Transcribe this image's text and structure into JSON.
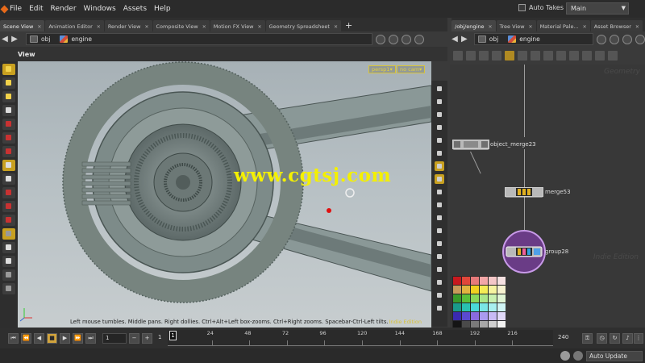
{
  "menu": [
    "File",
    "Edit",
    "Render",
    "Windows",
    "Assets",
    "Help"
  ],
  "auto_takes_label": "Auto Takes",
  "workspace": "Main",
  "left_tabs": [
    "Scene View",
    "Animation Editor",
    "Render View",
    "Composite View",
    "Motion FX View",
    "Geometry Spreadsheet"
  ],
  "right_tabs": [
    "/obj/engine",
    "Tree View",
    "Material Pale...",
    "Asset Browser"
  ],
  "left_path": {
    "segments": [
      "obj",
      "engine"
    ]
  },
  "right_path": {
    "segments": [
      "obj",
      "engine"
    ]
  },
  "view_title": "View",
  "camera": {
    "persp": "persp1▾",
    "cam": "no cam▾"
  },
  "viewport_status": "Left mouse tumbles. Middle pans. Right dollies. Ctrl+Alt+Left box-zooms. Ctrl+Right zooms. Spacebar-Ctrl-Left tilts.",
  "indie_edition": "Indie Edition",
  "watermark": "www.cgtsj.com",
  "network": {
    "context_label": "Geometry",
    "indie_label": "Indie Edition",
    "nodes": [
      {
        "name": "object_merge23"
      },
      {
        "name": "merge53"
      },
      {
        "name": "group28"
      }
    ]
  },
  "palette_colors": [
    "#c8191e",
    "#e0473a",
    "#e67a7a",
    "#f2a7a7",
    "#f4c7c7",
    "#f6e1e1",
    "#c89a5a",
    "#e0b440",
    "#f0d020",
    "#f5ec55",
    "#f6f3a0",
    "#f6f2d0",
    "#3a9a2a",
    "#5ac03a",
    "#8ad85a",
    "#aae68a",
    "#c8f0b0",
    "#e0f5d5",
    "#1a9a8a",
    "#2ac0b0",
    "#4ad8d8",
    "#7ae6e6",
    "#a8f0f0",
    "#d0f5f5",
    "#3a2ab0",
    "#5a4ad0",
    "#8a6ae0",
    "#aa9af0",
    "#c8baf5",
    "#e0d8f8",
    "#151515",
    "#4a4a4a",
    "#7a7a7a",
    "#a8a8a8",
    "#d0d0d0",
    "#f2f2f2"
  ],
  "timeline": {
    "current_frame": "1",
    "range_start": "1",
    "range_start2": "1",
    "range_end": "240",
    "ticks": [
      "24",
      "48",
      "72",
      "96",
      "120",
      "144",
      "168",
      "192",
      "216"
    ],
    "marker_frame": "1"
  },
  "auto_update": "Auto Update"
}
